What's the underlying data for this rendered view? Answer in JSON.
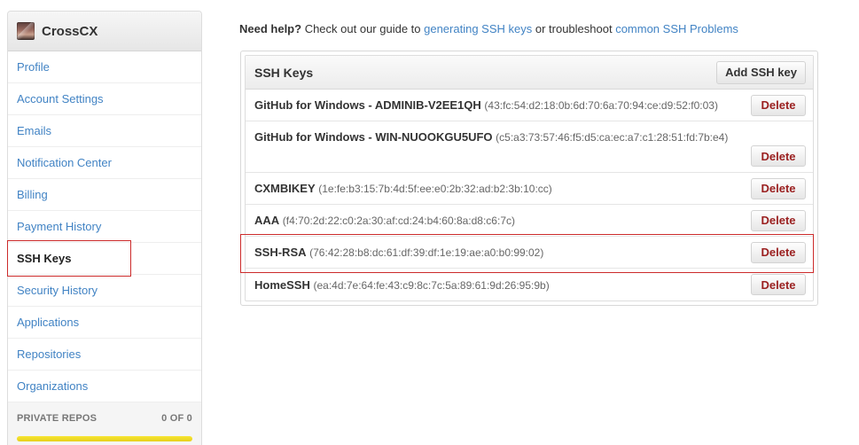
{
  "sidebar": {
    "username": "CrossCX",
    "items": [
      {
        "label": "Profile",
        "name": "sidebar-item-profile"
      },
      {
        "label": "Account Settings",
        "name": "sidebar-item-account-settings"
      },
      {
        "label": "Emails",
        "name": "sidebar-item-emails"
      },
      {
        "label": "Notification Center",
        "name": "sidebar-item-notification-center"
      },
      {
        "label": "Billing",
        "name": "sidebar-item-billing"
      },
      {
        "label": "Payment History",
        "name": "sidebar-item-payment-history"
      },
      {
        "label": "SSH Keys",
        "name": "sidebar-item-ssh-keys",
        "selected": true
      },
      {
        "label": "Security History",
        "name": "sidebar-item-security-history"
      },
      {
        "label": "Applications",
        "name": "sidebar-item-applications"
      },
      {
        "label": "Repositories",
        "name": "sidebar-item-repositories"
      },
      {
        "label": "Organizations",
        "name": "sidebar-item-organizations"
      }
    ],
    "private_repos": {
      "label": "PRIVATE REPOS",
      "count": "0 OF 0"
    }
  },
  "help": {
    "prefix": "Need help?",
    "text1": " Check out our guide to ",
    "link1": "generating SSH keys",
    "text2": " or troubleshoot ",
    "link2": "common SSH Problems"
  },
  "keys_panel": {
    "title": "SSH Keys",
    "add_button": "Add SSH key",
    "delete_label": "Delete",
    "keys": [
      {
        "name": "GitHub for Windows - ADMINIB-V2EE1QH",
        "fingerprint": "(43:fc:54:d2:18:0b:6d:70:6a:70:94:ce:d9:52:f0:03)"
      },
      {
        "name": "GitHub for Windows - WIN-NUOOKGU5UFO",
        "fingerprint": "(c5:a3:73:57:46:f5:d5:ca:ec:a7:c1:28:51:fd:7b:e4)",
        "wrapped": true
      },
      {
        "name": "CXMBIKEY",
        "fingerprint": "(1e:fe:b3:15:7b:4d:5f:ee:e0:2b:32:ad:b2:3b:10:cc)"
      },
      {
        "name": "AAA",
        "fingerprint": "(f4:70:2d:22:c0:2a:30:af:cd:24:b4:60:8a:d8:c6:7c)"
      },
      {
        "name": "SSH-RSA",
        "fingerprint": "(76:42:28:b8:dc:61:df:39:df:1e:19:ae:a0:b0:99:02)"
      },
      {
        "name": "HomeSSH",
        "fingerprint": "(ea:4d:7e:64:fe:43:c9:8c:7c:5a:89:61:9d:26:95:9b)"
      }
    ]
  },
  "colors": {
    "link": "#4183c4",
    "delete_text": "#9b2121",
    "highlight": "#cc2b2b",
    "repos_bar": "#f0dc28"
  }
}
